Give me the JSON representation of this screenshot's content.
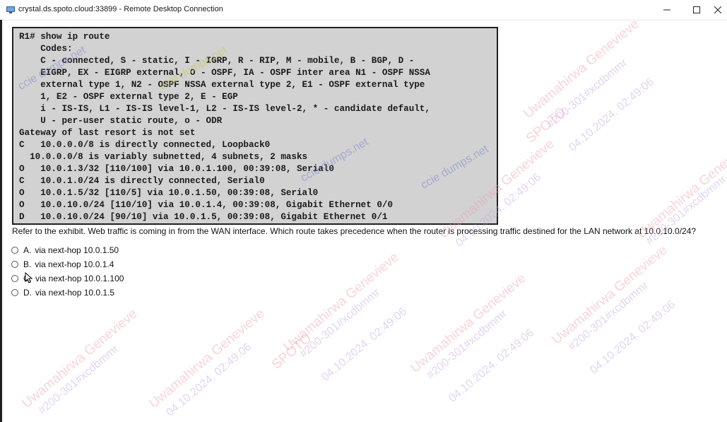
{
  "window": {
    "title": "crystal.ds.spoto.cloud:33899 - Remote Desktop Connection",
    "minimize_glyph": "—",
    "maximize_glyph": "☐",
    "close_glyph": "✕"
  },
  "exhibit": {
    "lines": [
      "R1# show ip route",
      "    Codes:",
      "    C - connected, S - static, I - IGRP, R - RIP, M - mobile, B - BGP, D -",
      "    EIGRP, EX - EIGRP external, O - OSPF, IA - OSPF inter area N1 - OSPF NSSA",
      "    external type 1, N2 - OSPF NSSA external type 2, E1 - OSPF external type",
      "    1, E2 - OSPF external type 2, E - EGP",
      "    i - IS-IS, L1 - IS-IS level-1, L2 - IS-IS level-2, * - candidate default,",
      "    U - per-user static route, o - ODR",
      "Gateway of last resort is not set",
      "C   10.0.0.0/8 is directly connected, Loopback0",
      "  10.0.0.0/8 is variably subnetted, 4 subnets, 2 masks",
      "O   10.0.1.3/32 [110/100] via 10.0.1.100, 00:39:08, Serial0",
      "C   10.0.1.0/24 is directly connected, Serial0",
      "O   10.0.1.5/32 [110/5] via 10.0.1.50, 00:39:08, Serial0",
      "O   10.0.10.0/24 [110/10] via 10.0.1.4, 00:39:08, Gigabit Ethernet 0/0",
      "D   10.0.10.0/24 [90/10] via 10.0.1.5, 00:39:08, Gigabit Ethernet 0/1"
    ]
  },
  "question": {
    "text": "Refer to the exhibit. Web traffic is coming in from the WAN interface. Which route takes precedence when the router is processing traffic destined for the LAN network at 10.0.10.0/24?",
    "options": [
      {
        "letter": "A.",
        "text": "via next-hop 10.0.1.50"
      },
      {
        "letter": "B.",
        "text": "via next-hop 10.0.1.4"
      },
      {
        "letter": "C.",
        "text": "via next-hop 10.0.1.100"
      },
      {
        "letter": "D.",
        "text": "via next-hop 10.0.1.5"
      }
    ]
  },
  "watermark": {
    "name": "Uwamahirwa Genevieve",
    "code": "#200-301#xcdbmmr",
    "date": "04.10.2024. 02:49:06",
    "brand": "SPOTO",
    "site": "ccie dumps.net"
  }
}
